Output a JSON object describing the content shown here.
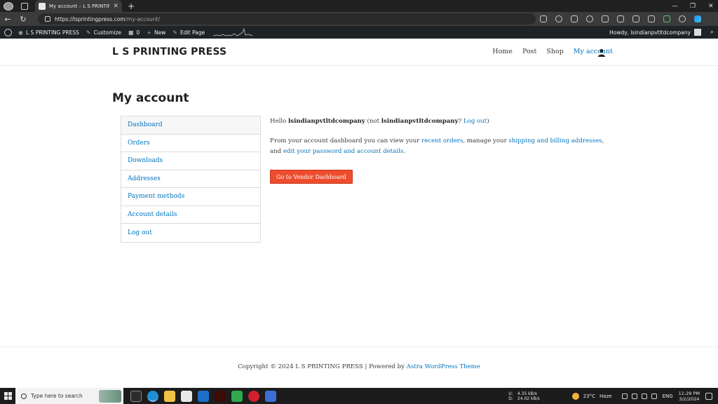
{
  "browser": {
    "tab_title": "My account – L S PRINTING PRESS",
    "url_domain": "https://lsprintingpress.com",
    "url_path": "/my-account/"
  },
  "admin_bar": {
    "site_name": "L S PRINTING PRESS",
    "customize": "Customize",
    "comments_count": "0",
    "new_label": "New",
    "edit_page": "Edit Page",
    "howdy": "Howdy, lsindianpvtltdcompany"
  },
  "site": {
    "title": "L S PRINTING PRESS",
    "nav": [
      "Home",
      "Post",
      "Shop",
      "My account"
    ]
  },
  "page": {
    "title": "My account"
  },
  "account_nav": [
    "Dashboard",
    "Orders",
    "Downloads",
    "Addresses",
    "Payment methods",
    "Account details",
    "Log out"
  ],
  "dashboard": {
    "hello": "Hello ",
    "username": "lsindianpvtltdcompany",
    "not_open": " (not ",
    "username2": "lsindianpvtltdcompany",
    "not_q": "? ",
    "logout_link": "Log out",
    "close": ")",
    "p2_a": "From your account dashboard you can view your ",
    "recent_orders": "recent orders",
    "p2_b": ", manage your ",
    "addresses_link": "shipping and billing addresses",
    "p2_c": ", and ",
    "edit_link": "edit your password and account details",
    "p2_d": ".",
    "vendor_button": "Go to Vendor Dashboard"
  },
  "footer": {
    "text": "Copyright © 2024 L S PRINTING PRESS | Powered by ",
    "theme_link": "Astra WordPress Theme"
  },
  "taskbar": {
    "search_placeholder": "Type here to search",
    "net_up_label": "U:",
    "net_down_label": "D:",
    "net_up": "4.35 kB/s",
    "net_down": "24.02 kB/s",
    "weather_temp": "23°C",
    "weather_desc": "Haze",
    "lang": "ENG",
    "time": "11:29 PM",
    "date": "3/2/2024"
  },
  "colors": {
    "link": "#0274be",
    "button": "#ee4d2d",
    "admin_bar": "#1d2327"
  }
}
